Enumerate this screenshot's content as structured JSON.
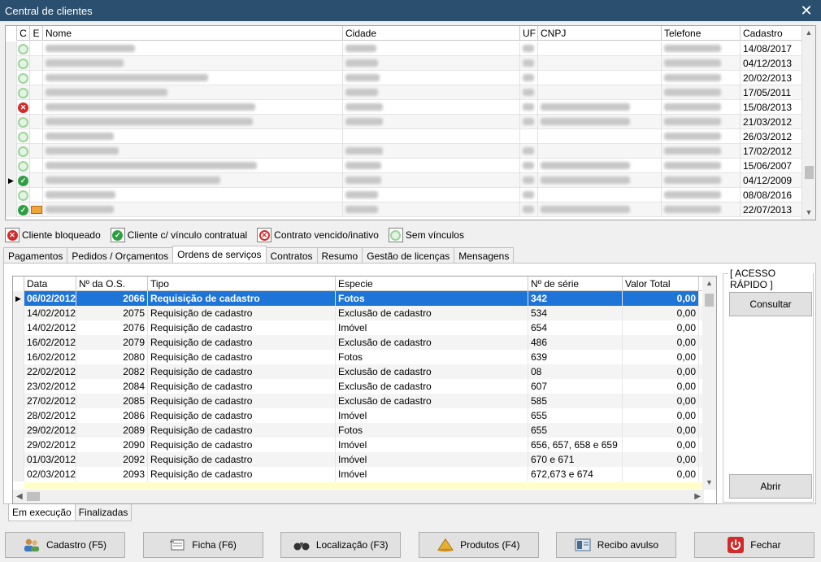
{
  "window": {
    "title": "Central de clientes"
  },
  "client_grid": {
    "columns": [
      "C",
      "E",
      "Nome",
      "Cidade",
      "UF",
      "CNPJ",
      "Telefone",
      "Cadastro"
    ],
    "rows": [
      {
        "status": "sem",
        "email": false,
        "cadastro": "14/08/2017",
        "cnpj": false
      },
      {
        "status": "sem",
        "email": false,
        "cadastro": "04/12/2013",
        "cnpj": false
      },
      {
        "status": "sem",
        "email": false,
        "cadastro": "20/02/2013",
        "cnpj": false
      },
      {
        "status": "sem",
        "email": false,
        "cadastro": "17/05/2011",
        "cnpj": false
      },
      {
        "status": "bloqueado",
        "email": false,
        "cadastro": "15/08/2013",
        "cnpj": true
      },
      {
        "status": "sem",
        "email": false,
        "cadastro": "21/03/2012",
        "cnpj": true
      },
      {
        "status": "sem",
        "email": false,
        "cadastro": "26/03/2012",
        "cnpj": false
      },
      {
        "status": "sem",
        "email": false,
        "cadastro": "17/02/2012",
        "cnpj": false
      },
      {
        "status": "sem",
        "email": false,
        "cadastro": "15/06/2007",
        "cnpj": true
      },
      {
        "status": "ok",
        "email": false,
        "cadastro": "04/12/2009",
        "cnpj": true,
        "current": true
      },
      {
        "status": "sem",
        "email": false,
        "cadastro": "08/08/2016",
        "cnpj": false
      },
      {
        "status": "ok",
        "email": true,
        "cadastro": "22/07/2013",
        "cnpj": true
      }
    ]
  },
  "legend": {
    "bloqueado": "Cliente bloqueado",
    "vinculo": "Cliente c/ vínculo contratual",
    "vencido": "Contrato vencido/inativo",
    "sem": "Sem vínculos"
  },
  "tabs": [
    "Pagamentos",
    "Pedidos / Orçamentos",
    "Ordens de serviços",
    "Contratos",
    "Resumo",
    "Gestão de licenças",
    "Mensagens"
  ],
  "active_tab": 2,
  "os_grid": {
    "columns": [
      "Data",
      "Nº da O.S.",
      "Tipo",
      "Especie",
      "Nº de série",
      "Valor Total"
    ],
    "rows": [
      [
        "06/02/2012",
        "2066",
        "Requisição de cadastro",
        "Fotos",
        "342",
        "0,00"
      ],
      [
        "14/02/2012",
        "2075",
        "Requisição de cadastro",
        "Exclusão de cadastro",
        "534",
        "0,00"
      ],
      [
        "14/02/2012",
        "2076",
        "Requisição de cadastro",
        "Imóvel",
        "654",
        "0,00"
      ],
      [
        "16/02/2012",
        "2079",
        "Requisição de cadastro",
        "Exclusão de cadastro",
        "486",
        "0,00"
      ],
      [
        "16/02/2012",
        "2080",
        "Requisição de cadastro",
        "Fotos",
        "639",
        "0,00"
      ],
      [
        "22/02/2012",
        "2082",
        "Requisição de cadastro",
        "Exclusão de cadastro",
        "08",
        "0,00"
      ],
      [
        "23/02/2012",
        "2084",
        "Requisição de cadastro",
        "Exclusão de cadastro",
        "607",
        "0,00"
      ],
      [
        "27/02/2012",
        "2085",
        "Requisição de cadastro",
        "Exclusão de cadastro",
        "585",
        "0,00"
      ],
      [
        "28/02/2012",
        "2086",
        "Requisição de cadastro",
        "Imóvel",
        "655",
        "0,00"
      ],
      [
        "29/02/2012",
        "2089",
        "Requisição de cadastro",
        "Fotos",
        "655",
        "0,00"
      ],
      [
        "29/02/2012",
        "2090",
        "Requisição de cadastro",
        "Imóvel",
        "656, 657, 658 e 659",
        "0,00"
      ],
      [
        "01/03/2012",
        "2092",
        "Requisição de cadastro",
        "Imóvel",
        "670 e 671",
        "0,00"
      ],
      [
        "02/03/2012",
        "2093",
        "Requisição de cadastro",
        "Imóvel",
        "672,673 e 674",
        "0,00"
      ]
    ]
  },
  "acesso_rapido": {
    "label": "[ ACESSO RÁPIDO ]",
    "consultar": "Consultar",
    "abrir": "Abrir"
  },
  "subtabs": [
    "Em execução",
    "Finalizadas"
  ],
  "buttons": {
    "cadastro": "Cadastro (F5)",
    "ficha": "Ficha (F6)",
    "localizacao": "Localização (F3)",
    "produtos": "Produtos (F4)",
    "recibo": "Recibo avulso",
    "fechar": "Fechar"
  },
  "colors": {
    "titlebar": "#2b4f6e",
    "selection": "#1f74d8",
    "ok": "#2ea043",
    "blocked": "#d32a2a"
  }
}
